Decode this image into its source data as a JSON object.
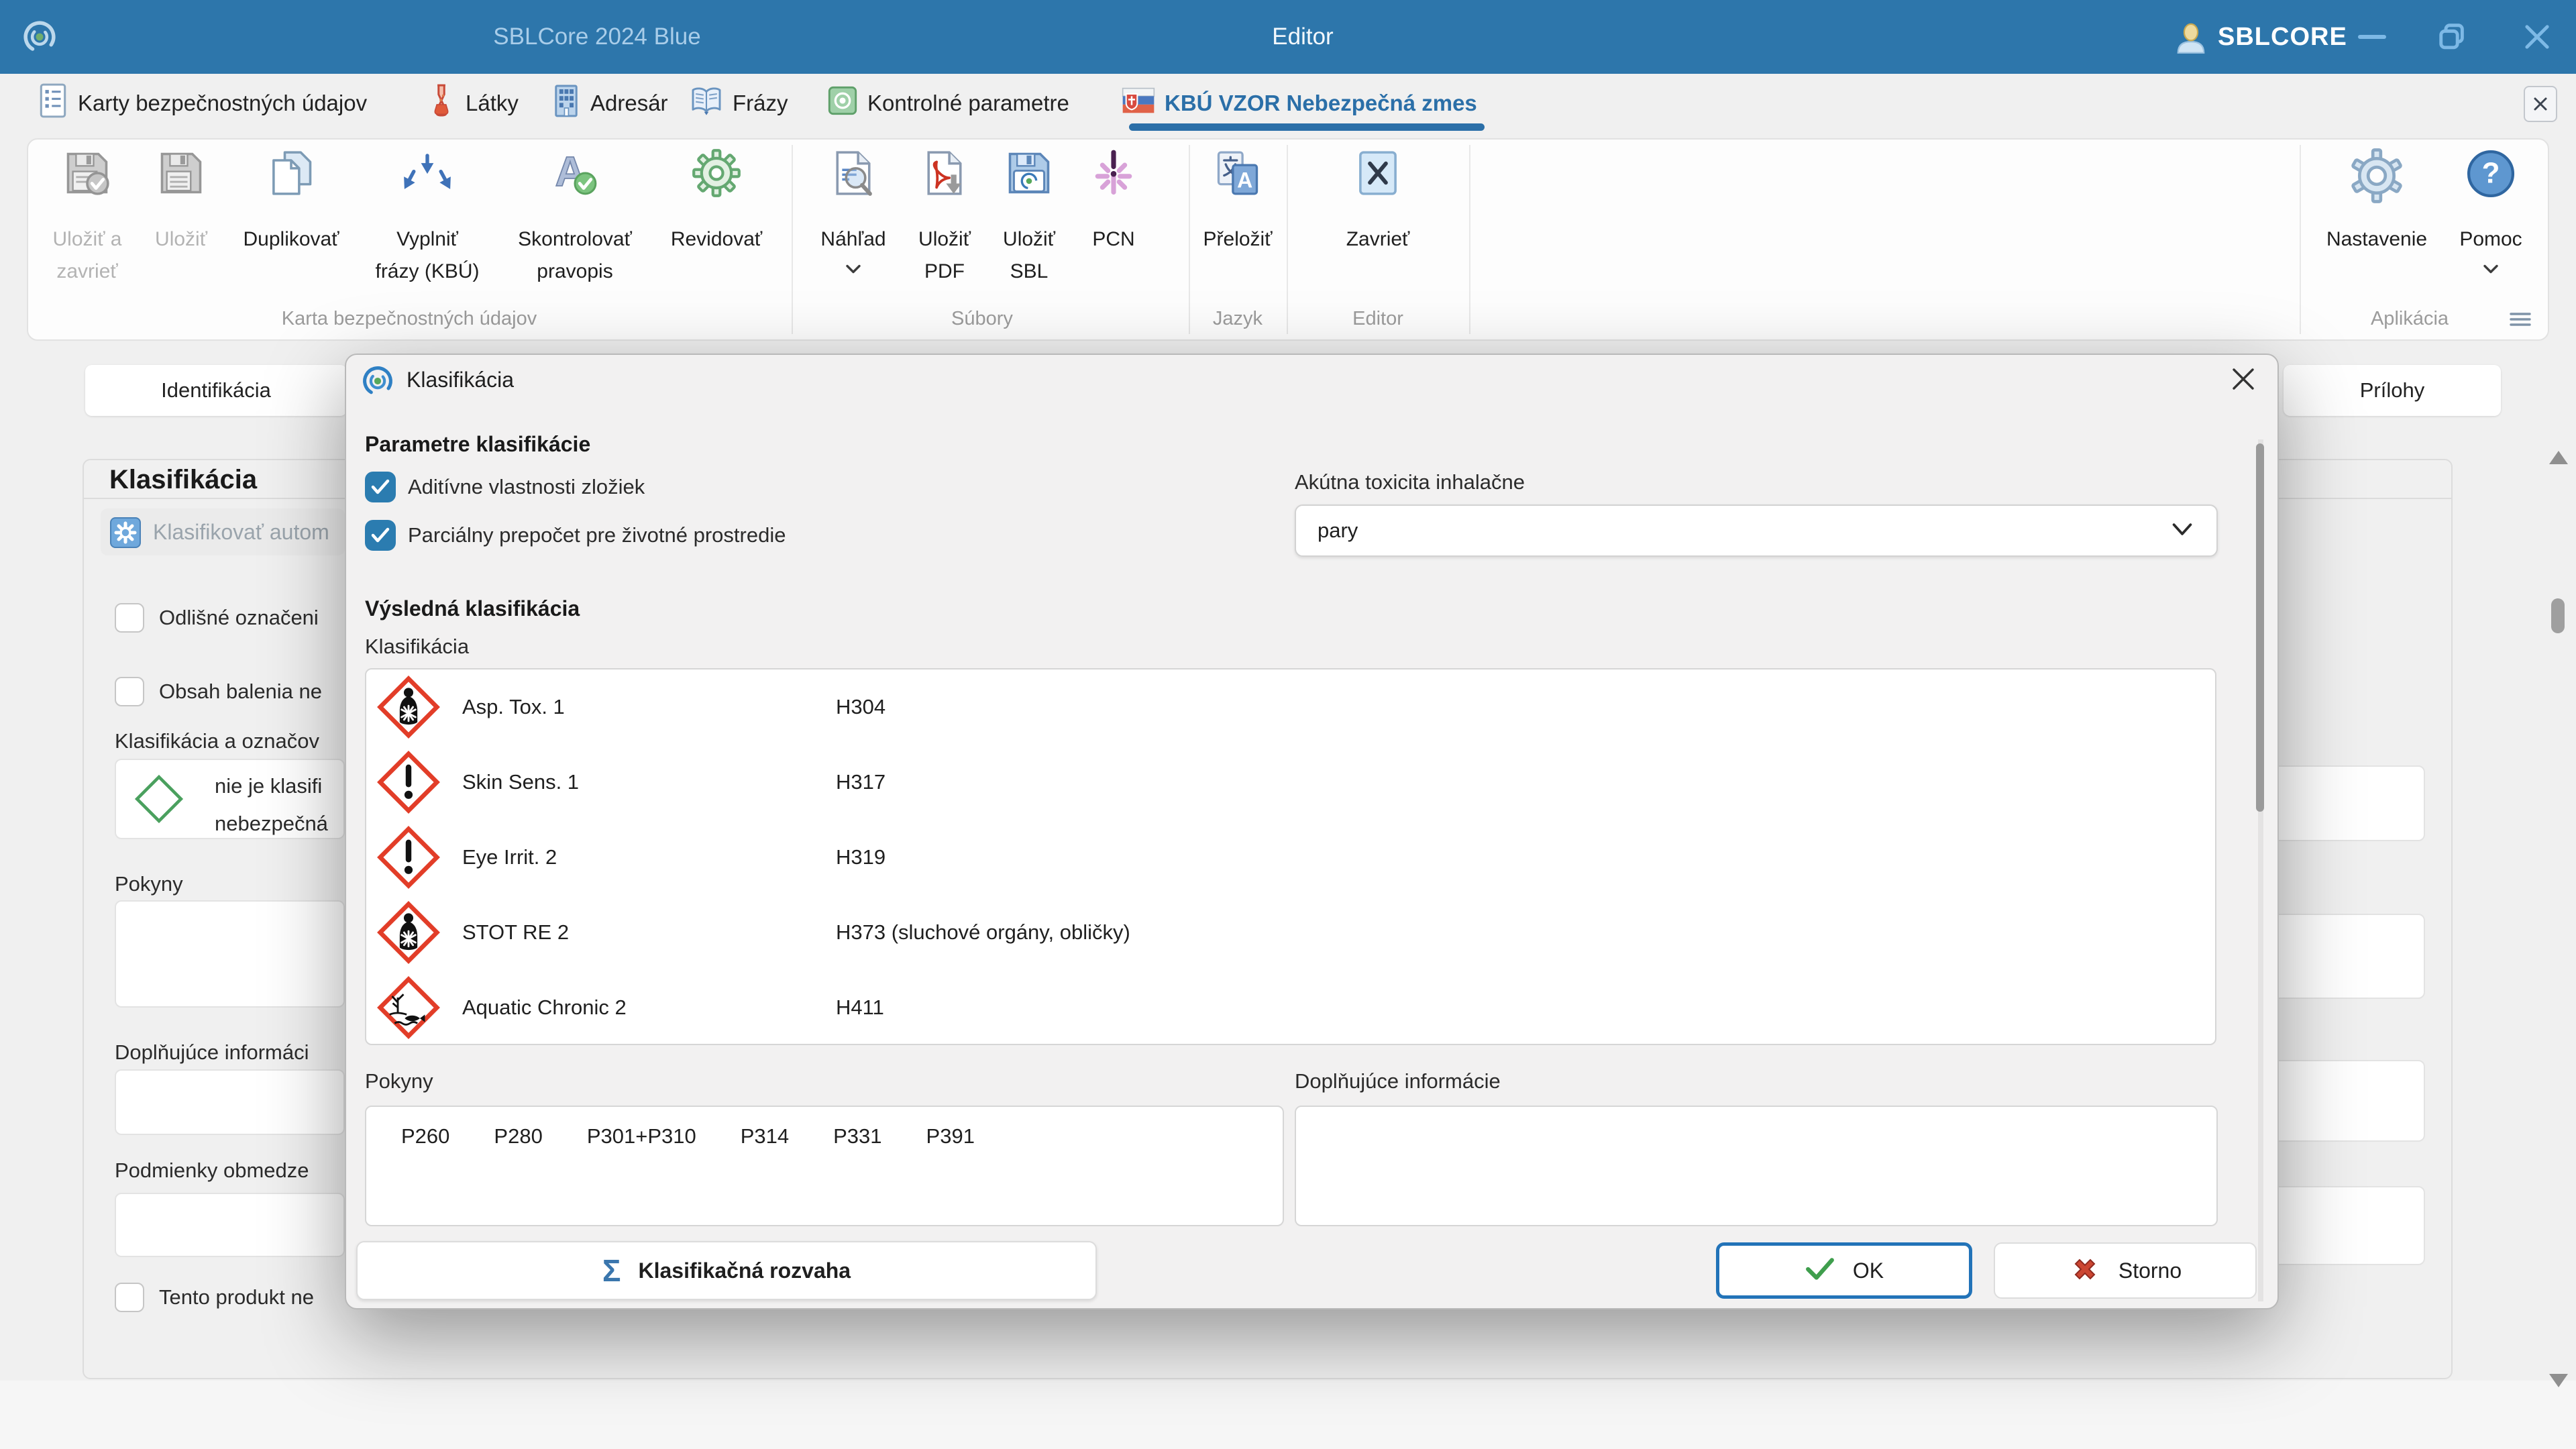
{
  "colors": {
    "titlebar": "#2d76ab",
    "accent_blue": "#2b6fa8",
    "checkbox_blue": "#2b7cb0",
    "ghs_red": "#e23d28",
    "ok_border_blue": "#2273b8",
    "cancel_red": "#cc4632",
    "check_green": "#3f9e4d",
    "not_classified_green": "#4aa05e"
  },
  "titlebar": {
    "app_title": "SBLCore 2024 Blue",
    "window_title": "Editor",
    "user": "SBLCORE"
  },
  "tabs": {
    "items": [
      "Karty bezpečnostných údajov",
      "Látky",
      "Adresár",
      "Frázy",
      "Kontrolné parametre",
      "KBÚ VZOR Nebezpečná zmes"
    ]
  },
  "toolbar": {
    "groups": {
      "sds": "Karta bezpečnostných údajov",
      "files": "Súbory",
      "language": "Jazyk",
      "editor": "Editor",
      "app": "Aplikácia"
    },
    "buttons": {
      "save_close": {
        "line1": "Uložiť a",
        "line2": "zavrieť"
      },
      "save": {
        "line1": "Uložiť"
      },
      "duplicate": {
        "line1": "Duplikovať"
      },
      "fill_phrases": {
        "line1": "Vyplniť",
        "line2": "frázy (KBÚ)"
      },
      "spellcheck": {
        "line1": "Skontrolovať",
        "line2": "pravopis"
      },
      "revise": {
        "line1": "Revidovať"
      },
      "preview": {
        "line1": "Náhľad"
      },
      "save_pdf": {
        "line1": "Uložiť",
        "line2": "PDF"
      },
      "save_sbl": {
        "line1": "Uložiť",
        "line2": "SBL"
      },
      "pcn": {
        "line1": "PCN"
      },
      "translate": {
        "line1": "Přeložiť"
      },
      "close_editor": {
        "line1": "Zavrieť"
      },
      "settings": {
        "line1": "Nastavenie"
      },
      "help": {
        "line1": "Pomoc"
      }
    }
  },
  "form": {
    "tab_left": "Identifikácia",
    "tab_right": "Prílohy",
    "section_title": "Klasifikácia",
    "classify_auto": "Klasifikovať autom",
    "checkbox_different_label": "Odlišné označeni",
    "checkbox_package_label": "Obsah balenia ne",
    "classification_label": "Klasifikácia a označov",
    "not_classified_line1": "nie je klasifi",
    "not_classified_line2": "nebezpečná",
    "pokyny_label": "Pokyny",
    "dopl_label": "Doplňujúce informáci",
    "podmienky_label": "Podmienky obmedze",
    "checkbox_product_label": "Tento produkt ne"
  },
  "dialog": {
    "title": "Klasifikácia",
    "params_heading": "Parametre klasifikácie",
    "checkbox_additive": "Aditívne vlastnosti zložiek",
    "checkbox_partial": "Parciálny prepočet pre životné prostredie",
    "acute_label": "Akútna toxicita inhalačne",
    "acute_value": "pary",
    "result_heading": "Výsledná klasifikácia",
    "list_label": "Klasifikácia",
    "rows": [
      {
        "pictogram": "ghs08-health-hazard",
        "name": "Asp. Tox. 1",
        "code": "H304"
      },
      {
        "pictogram": "ghs07-exclamation",
        "name": "Skin Sens. 1",
        "code": "H317"
      },
      {
        "pictogram": "ghs07-exclamation",
        "name": "Eye Irrit. 2",
        "code": "H319"
      },
      {
        "pictogram": "ghs08-health-hazard",
        "name": "STOT RE 2",
        "code": "H373 (sluchové orgány, obličky)"
      },
      {
        "pictogram": "ghs09-environment",
        "name": "Aquatic Chronic 2",
        "code": "H411"
      }
    ],
    "pokyny_label": "Pokyny",
    "p_codes": [
      "P260",
      "P280",
      "P301+P310",
      "P314",
      "P331",
      "P391"
    ],
    "dopl_label": "Doplňujúce informácie",
    "balance_button": "Klasifikačná rozvaha",
    "ok_button": "OK",
    "cancel_button": "Storno"
  }
}
